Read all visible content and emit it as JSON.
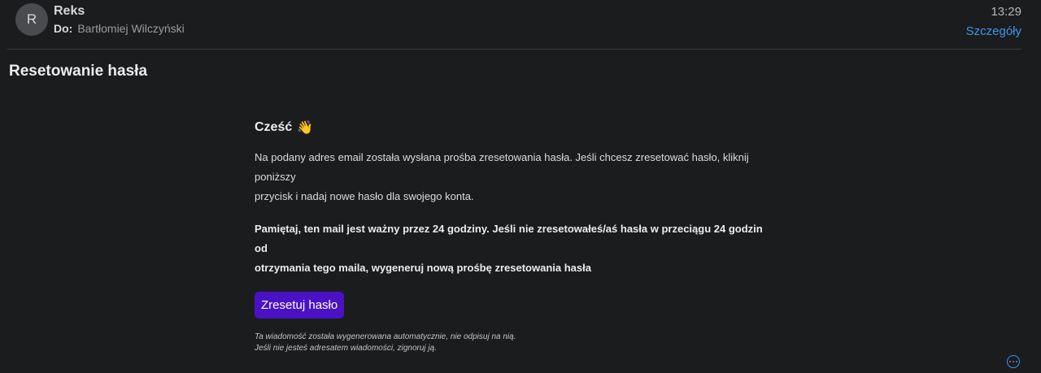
{
  "header": {
    "avatar_initial": "R",
    "sender": "Reks",
    "to_label": "Do:",
    "to_name": "Bartłomiej Wilczyński",
    "time": "13:29",
    "details_label": "Szczegóły"
  },
  "subject": "Resetowanie hasła",
  "body": {
    "greeting": "Cześć",
    "greeting_emoji": "👋",
    "paragraph1_line1": "Na podany adres email została wysłana prośba zresetowania hasła. Jeśli chcesz zresetować hasło, kliknij poniższy",
    "paragraph1_line2": "przycisk i nadaj nowe hasło dla swojego konta.",
    "paragraph2_line1": "Pamiętaj, ten mail jest ważny przez 24 godziny. Jeśli nie zresetowałeś/aś hasła w przeciągu 24 godzin od",
    "paragraph2_line2": "otrzymania tego maila, wygeneruj nową prośbę zresetowania hasła",
    "button_label": "Zresetuj hasło",
    "footnote_line1": "Ta wiadomość została wygenerowana automatycznie, nie odpisuj na nią.",
    "footnote_line2": "Jeśli nie jesteś adresatem wiadomości, zignoruj ją."
  },
  "colors": {
    "background": "#1b1c1e",
    "accent_link": "#3d97e6",
    "button": "#4a12c4"
  },
  "icons": {
    "more": "more-options-icon"
  }
}
